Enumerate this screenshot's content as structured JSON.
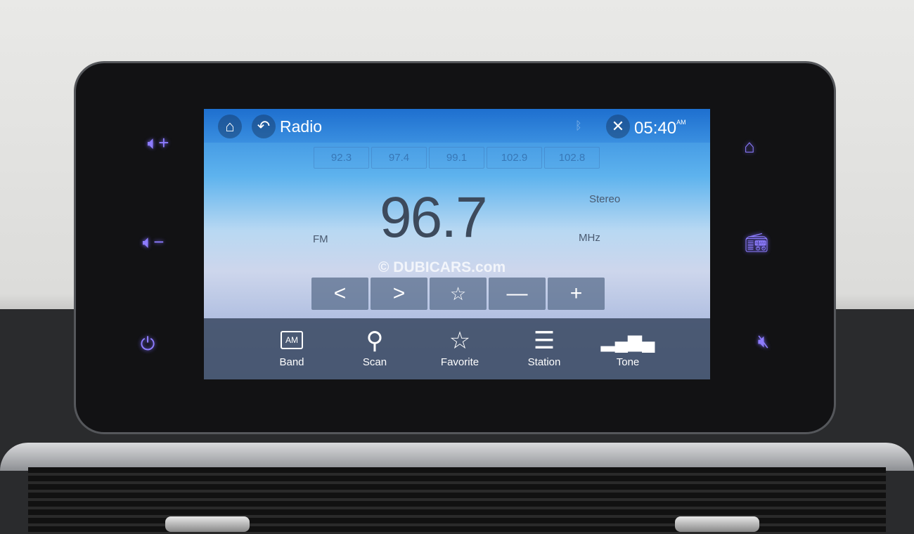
{
  "header": {
    "title": "Radio",
    "time": "05:40",
    "ampm": "AM"
  },
  "presets": [
    "92.3",
    "97.4",
    "99.1",
    "102.9",
    "102.8"
  ],
  "tuner": {
    "frequency": "96.7",
    "band": "FM",
    "unit": "MHz",
    "mode": "Stereo"
  },
  "watermark": "© DUBICARS.com",
  "controls": [
    "prev-icon",
    "next-icon",
    "star-icon",
    "minus-icon",
    "plus-icon"
  ],
  "tabs": [
    {
      "label": "Band",
      "icon_text": "AM"
    },
    {
      "label": "Scan"
    },
    {
      "label": "Favorite"
    },
    {
      "label": "Station"
    },
    {
      "label": "Tone"
    }
  ],
  "accent": "#8d7cff"
}
